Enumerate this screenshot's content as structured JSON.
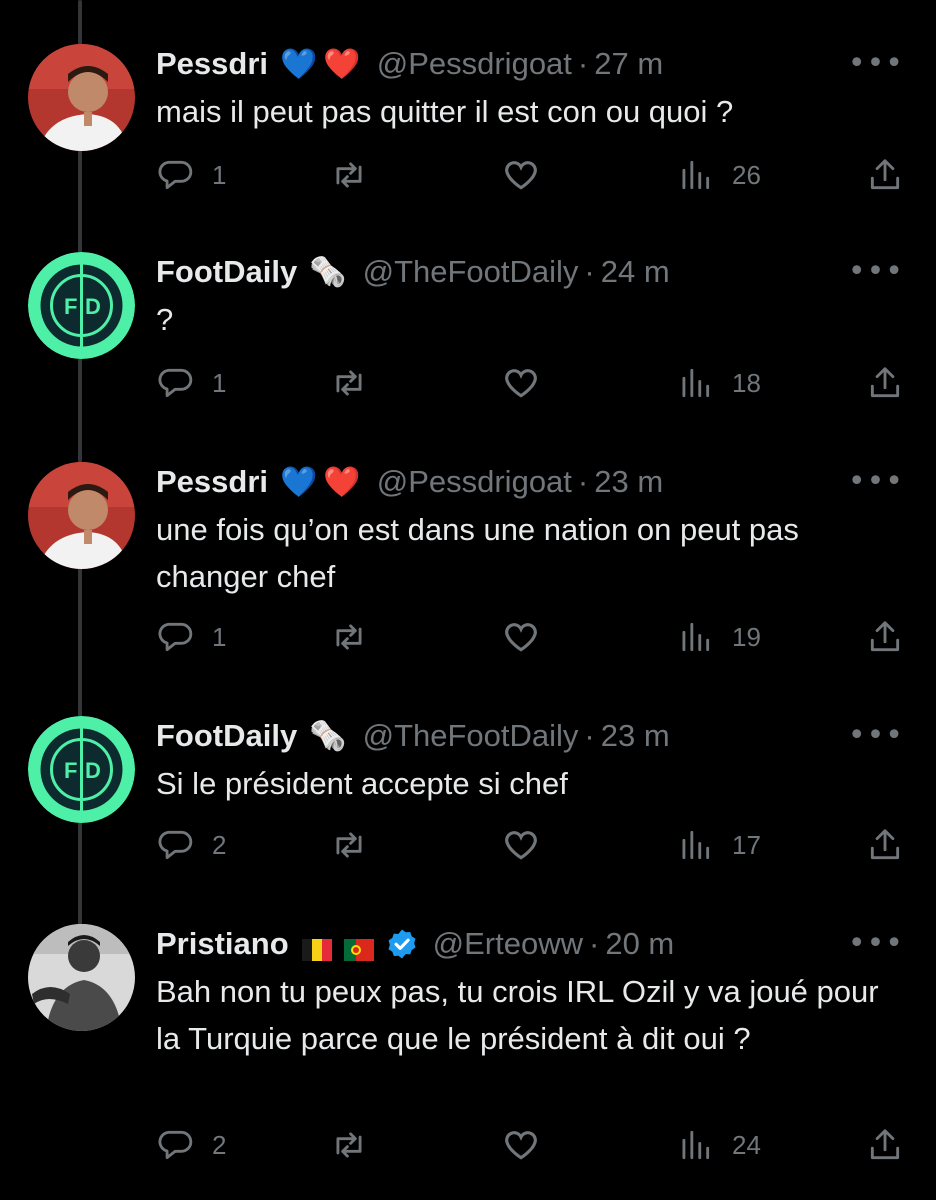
{
  "tweets": [
    {
      "name": "Pessdri",
      "badges": [
        "💙",
        "❤️"
      ],
      "handle": "@Pessdrigoat",
      "time": "27 m",
      "text": "mais il peut pas quitter il est con ou quoi ?",
      "replies": "1",
      "views": "26"
    },
    {
      "name": "FootDaily",
      "badges": [
        "🗞️"
      ],
      "handle": "@TheFootDaily",
      "time": "24 m",
      "text": "?",
      "replies": "1",
      "views": "18"
    },
    {
      "name": "Pessdri",
      "badges": [
        "💙",
        "❤️"
      ],
      "handle": "@Pessdrigoat",
      "time": "23 m",
      "text": "une fois qu’on est dans une nation on peut pas changer chef",
      "replies": "1",
      "views": "19"
    },
    {
      "name": "FootDaily",
      "badges": [
        "🗞️"
      ],
      "handle": "@TheFootDaily",
      "time": "23 m",
      "text": "Si le président accepte si chef",
      "replies": "2",
      "views": "17"
    },
    {
      "name": "Pristiano",
      "badges": [
        "🇧🇪",
        "🇵🇹"
      ],
      "handle": "@Erteoww",
      "time": "20 m",
      "text": "Bah non tu peux pas, tu crois IRL Ozil y va joué pour la Turquie parce que le président à dit oui ?",
      "replies": "2",
      "views": "24"
    }
  ],
  "ui": {
    "dot": "·",
    "more": "•••",
    "verified_color": "#1d9bf0",
    "muted_color": "#71767b",
    "avatar_footdaily_color": "#4ef0a8"
  }
}
